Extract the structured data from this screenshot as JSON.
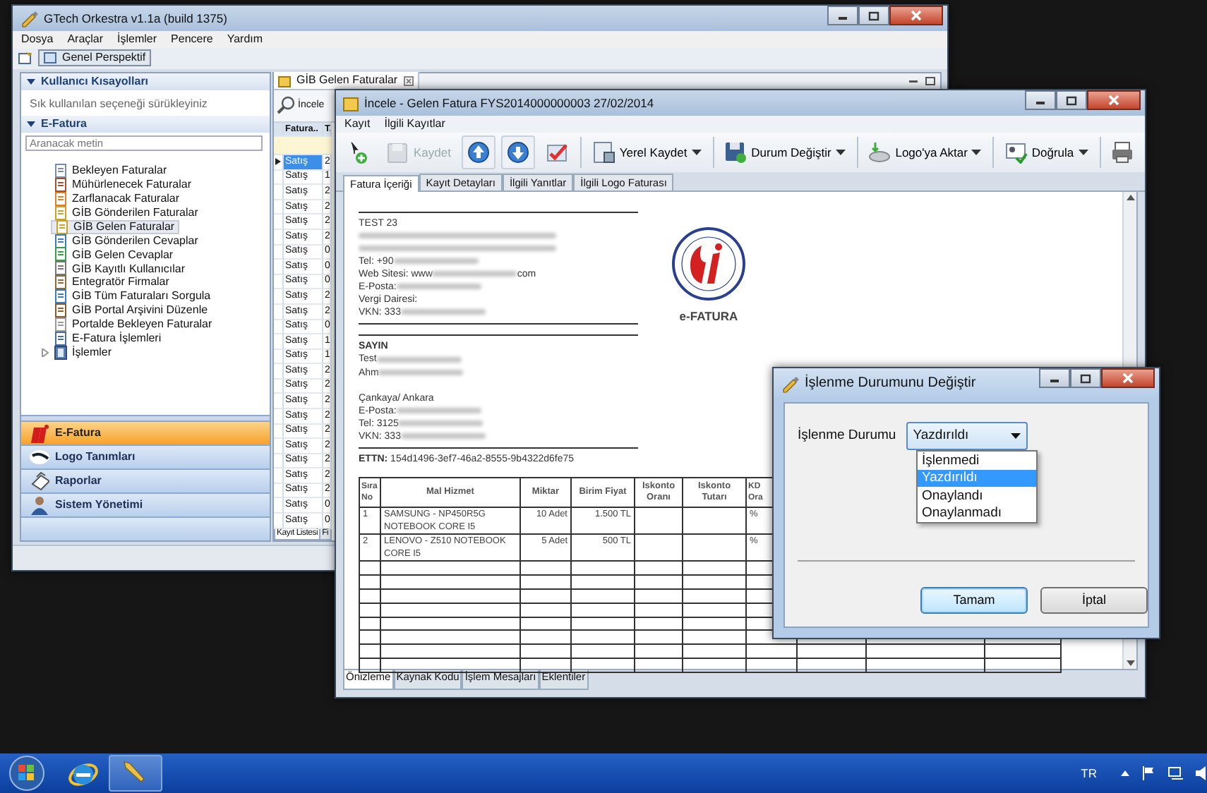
{
  "main_window": {
    "title": "GTech Orkestra v1.1a (build 1375)",
    "menu": [
      "Dosya",
      "Araçlar",
      "İşlemler",
      "Pencere",
      "Yardım"
    ],
    "perspective_button": "Genel Perspektif",
    "sidebar": {
      "shortcuts": {
        "title": "Kullanıcı Kısayolları",
        "expanded": true,
        "hint": "Sık kullanılan seçeneği sürükleyiniz"
      },
      "efatura": {
        "title": "E-Fatura",
        "expanded": true,
        "search": {
          "placeholder": "Aranacak metin"
        },
        "items": [
          {
            "label": "Bekleyen Faturalar",
            "kind": "item",
            "selected": false
          },
          {
            "label": "Mühürlenecek Faturalar",
            "kind": "item",
            "selected": false
          },
          {
            "label": "Zarflanacak Faturalar",
            "kind": "item",
            "selected": false
          },
          {
            "label": "GİB Gönderilen Faturalar",
            "kind": "item",
            "selected": false
          },
          {
            "label": "GİB Gelen Faturalar",
            "kind": "item",
            "selected": true
          },
          {
            "label": "GİB Gönderilen Cevaplar",
            "kind": "item",
            "selected": false
          },
          {
            "label": "GİB Gelen Cevaplar",
            "kind": "item",
            "selected": false
          },
          {
            "label": "GİB Kayıtlı Kullanıcılar",
            "kind": "item",
            "selected": false
          },
          {
            "label": "Entegratör Firmalar",
            "kind": "item",
            "selected": false
          },
          {
            "label": "GİB Tüm Faturaları Sorgula",
            "kind": "item",
            "selected": false
          },
          {
            "label": "GİB Portal Arşivini Düzenle",
            "kind": "item",
            "selected": false
          },
          {
            "label": "Portalde Bekleyen Faturalar",
            "kind": "item",
            "selected": false
          },
          {
            "label": "E-Fatura İşlemleri",
            "kind": "item",
            "selected": false
          },
          {
            "label": "İşlemler",
            "kind": "group",
            "selected": false,
            "expanded": false
          }
        ]
      },
      "nav": [
        {
          "label": "E-Fatura",
          "selected": true
        },
        {
          "label": "Logo Tanımları",
          "selected": false
        },
        {
          "label": "Raporlar",
          "selected": false
        },
        {
          "label": "Sistem Yönetimi",
          "selected": false
        }
      ]
    },
    "list_panel": {
      "tab": "GİB Gelen Faturalar",
      "toolbar_button": "İncele",
      "columns": [
        "Fatura..",
        "T."
      ],
      "rows": [
        {
          "cells": [
            "Satış",
            "2"
          ],
          "selected": true
        },
        {
          "cells": [
            "Satış",
            "1"
          ],
          "selected": false
        },
        {
          "cells": [
            "Satış",
            "2"
          ],
          "selected": false
        },
        {
          "cells": [
            "Satış",
            "2"
          ],
          "selected": false
        },
        {
          "cells": [
            "Satış",
            "2"
          ],
          "selected": false
        },
        {
          "cells": [
            "Satış",
            "2"
          ],
          "selected": false
        },
        {
          "cells": [
            "Satış",
            "0"
          ],
          "selected": false
        },
        {
          "cells": [
            "Satış",
            "0"
          ],
          "selected": false
        },
        {
          "cells": [
            "Satış",
            "0"
          ],
          "selected": false
        },
        {
          "cells": [
            "Satış",
            "2"
          ],
          "selected": false
        },
        {
          "cells": [
            "Satış",
            "2"
          ],
          "selected": false
        },
        {
          "cells": [
            "Satış",
            "0"
          ],
          "selected": false
        },
        {
          "cells": [
            "Satış",
            "1"
          ],
          "selected": false
        },
        {
          "cells": [
            "Satış",
            "1"
          ],
          "selected": false
        },
        {
          "cells": [
            "Satış",
            "2"
          ],
          "selected": false
        },
        {
          "cells": [
            "Satış",
            "2"
          ],
          "selected": false
        },
        {
          "cells": [
            "Satış",
            "2"
          ],
          "selected": false
        },
        {
          "cells": [
            "Satış",
            "2"
          ],
          "selected": false
        },
        {
          "cells": [
            "Satış",
            "2"
          ],
          "selected": false
        },
        {
          "cells": [
            "Satış",
            "2"
          ],
          "selected": false
        },
        {
          "cells": [
            "Satış",
            "2"
          ],
          "selected": false
        },
        {
          "cells": [
            "Satış",
            "2"
          ],
          "selected": false
        },
        {
          "cells": [
            "Satış",
            "2"
          ],
          "selected": false
        },
        {
          "cells": [
            "Satış",
            "0"
          ],
          "selected": false
        },
        {
          "cells": [
            "Satış",
            "0"
          ],
          "selected": false
        }
      ],
      "bottom_tabs": [
        {
          "label": "Kayıt Listesi",
          "selected": true
        },
        {
          "label": "Fi",
          "selected": false
        }
      ]
    }
  },
  "invoice_window": {
    "title": "İncele - Gelen Fatura FYS2014000000003 27/02/2014",
    "menu": [
      "Kayıt",
      "İlgili Kayıtlar"
    ],
    "toolbar": [
      {
        "kind": "add",
        "disabled": false
      },
      {
        "kind": "save",
        "label": "Kaydet",
        "disabled": true
      },
      {
        "kind": "up",
        "disabled": false
      },
      {
        "kind": "down",
        "disabled": false
      },
      {
        "kind": "check",
        "disabled": false
      },
      {
        "kind": "dropdown",
        "label": "Yerel Kaydet",
        "disabled": false
      },
      {
        "kind": "dropdown",
        "label": "Durum Değiştir",
        "disabled": false
      },
      {
        "kind": "dropdown",
        "label": "Logo'ya Aktar",
        "disabled": false
      },
      {
        "kind": "dropdown",
        "label": "Doğrula",
        "disabled": false
      },
      {
        "kind": "print",
        "disabled": false
      }
    ],
    "tabs": [
      {
        "label": "Fatura İçeriği",
        "selected": true
      },
      {
        "label": "Kayıt Detayları",
        "selected": false
      },
      {
        "label": "İlgili Yanıtlar",
        "selected": false
      },
      {
        "label": "İlgili Logo Faturası",
        "selected": false
      }
    ],
    "document": {
      "seller": [
        {
          "parts": [
            {
              "kind": "text",
              "text": "TEST 23"
            }
          ]
        },
        {
          "parts": [
            {
              "kind": "blur"
            }
          ]
        },
        {
          "parts": [
            {
              "kind": "blur"
            }
          ]
        },
        {
          "parts": [
            {
              "kind": "text",
              "text": "Tel: +90"
            },
            {
              "kind": "blur"
            }
          ]
        },
        {
          "parts": [
            {
              "kind": "text",
              "text": "Web Sitesi: www"
            },
            {
              "kind": "blur"
            },
            {
              "kind": "text",
              "text": "com"
            }
          ]
        },
        {
          "parts": [
            {
              "kind": "text",
              "text": "E-Posta:"
            },
            {
              "kind": "blur"
            }
          ]
        },
        {
          "parts": [
            {
              "kind": "text",
              "text": "Vergi Dairesi:"
            }
          ]
        },
        {
          "parts": [
            {
              "kind": "text",
              "text": "VKN: 333"
            },
            {
              "kind": "blur"
            }
          ]
        }
      ],
      "buyer_heading": "SAYIN",
      "buyer": [
        {
          "parts": [
            {
              "kind": "text",
              "text": "Test"
            },
            {
              "kind": "blur"
            }
          ]
        },
        {
          "parts": [
            {
              "kind": "text",
              "text": "Ahm"
            },
            {
              "kind": "blur"
            }
          ]
        }
      ],
      "buyer_address": [
        {
          "parts": [
            {
              "kind": "text",
              "text": "Çankaya/ Ankara"
            }
          ]
        },
        {
          "parts": [
            {
              "kind": "text",
              "text": "E-Posta:"
            },
            {
              "kind": "blur"
            }
          ]
        },
        {
          "parts": [
            {
              "kind": "text",
              "text": "Tel: 3125"
            },
            {
              "kind": "blur"
            }
          ]
        },
        {
          "parts": [
            {
              "kind": "text",
              "text": "VKN: 333"
            },
            {
              "kind": "blur"
            }
          ]
        }
      ],
      "logo_caption": "e-FATURA",
      "ettn_label": "ETTN:",
      "ettn": "154d1496-3ef7-46a2-8555-9b4322d6fe75",
      "table": {
        "columns": [
          "Sıra No",
          "Mal Hizmet",
          "Miktar",
          "Birim Fiyat",
          "Iskonto Oranı",
          "Iskonto Tutarı",
          "KD Ora"
        ],
        "rows": [
          [
            "1",
            "SAMSUNG - NP450R5G NOTEBOOK CORE I5",
            "10 Adet",
            "1.500 TL",
            "",
            "",
            "%"
          ],
          [
            "2",
            "LENOVO - Z510 NOTEBOOK CORE I5",
            "5 Adet",
            "500 TL",
            "",
            "",
            "%"
          ]
        ]
      }
    },
    "bottom_tabs": [
      {
        "label": "Önizleme",
        "selected": true
      },
      {
        "label": "Kaynak Kodu",
        "selected": false
      },
      {
        "label": "İşlem Mesajları",
        "selected": false
      },
      {
        "label": "Eklentiler",
        "selected": false
      }
    ]
  },
  "dialog": {
    "title": "İşlenme Durumunu Değiştir",
    "field_label": "İşlenme Durumu",
    "value": "Yazdırıldı",
    "options": [
      {
        "label": "İşlenmedi",
        "selected": false
      },
      {
        "label": "Yazdırıldı",
        "selected": true
      },
      {
        "label": "Onaylandı",
        "selected": false
      },
      {
        "label": "Onaylanmadı",
        "selected": false
      }
    ],
    "buttons": [
      {
        "label": "Tamam",
        "default": true
      },
      {
        "label": "İptal",
        "default": false
      }
    ]
  },
  "taskbar": {
    "language": "TR"
  }
}
